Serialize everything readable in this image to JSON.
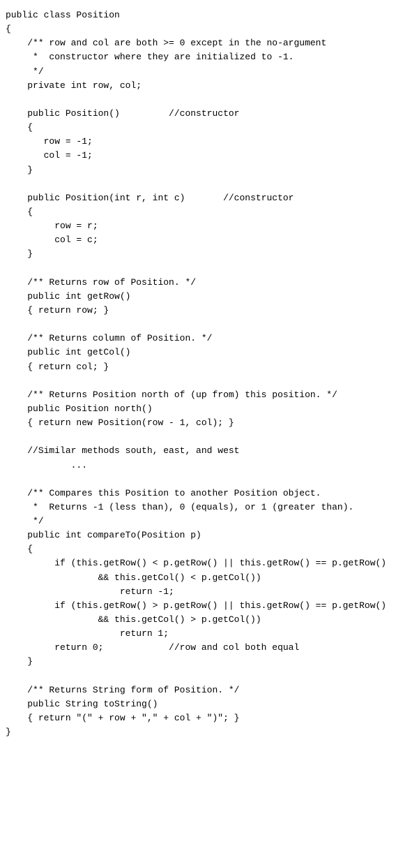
{
  "code": {
    "content": "public class Position\n{\n    /** row and col are both >= 0 except in the no-argument\n     *  constructor where they are initialized to -1.\n     */\n    private int row, col;\n\n    public Position()         //constructor\n    {\n       row = -1;\n       col = -1;\n    }\n\n    public Position(int r, int c)       //constructor\n    {\n         row = r;\n         col = c;\n    }\n\n    /** Returns row of Position. */\n    public int getRow()\n    { return row; }\n\n    /** Returns column of Position. */\n    public int getCol()\n    { return col; }\n\n    /** Returns Position north of (up from) this position. */\n    public Position north()\n    { return new Position(row - 1, col); }\n\n    //Similar methods south, east, and west\n            ...\n\n    /** Compares this Position to another Position object.\n     *  Returns -1 (less than), 0 (equals), or 1 (greater than).\n     */\n    public int compareTo(Position p)\n    {\n         if (this.getRow() < p.getRow() || this.getRow() == p.getRow()\n                 && this.getCol() < p.getCol())\n                     return -1;\n         if (this.getRow() > p.getRow() || this.getRow() == p.getRow()\n                 && this.getCol() > p.getCol())\n                     return 1;\n         return 0;            //row and col both equal\n    }\n\n    /** Returns String form of Position. */\n    public String toString()\n    { return \"(\" + row + \",\" + col + \")\"; }\n}"
  }
}
